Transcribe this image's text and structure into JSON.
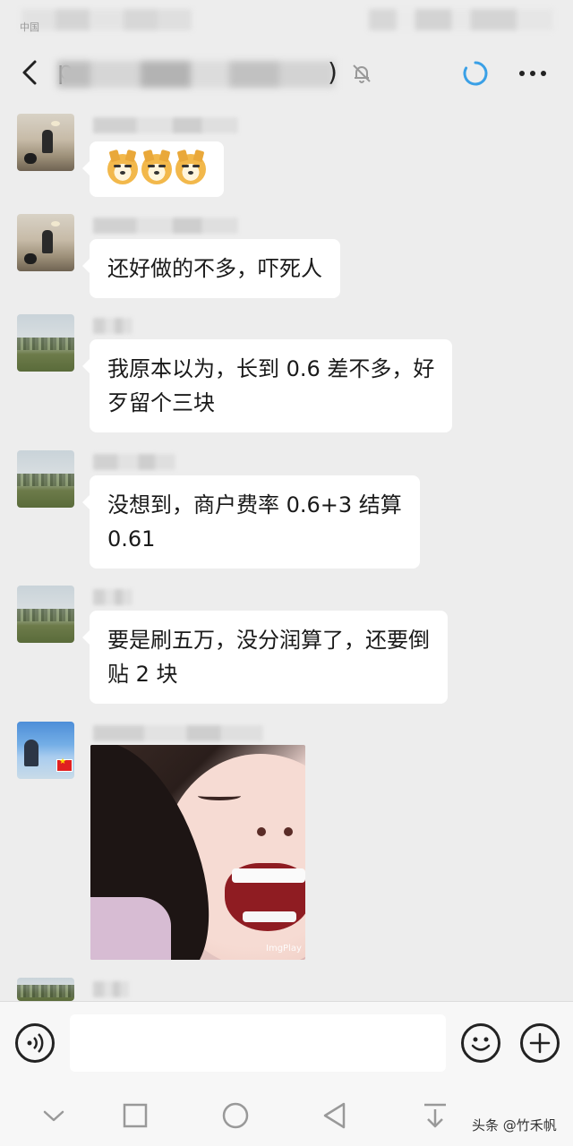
{
  "status_bar": {
    "carrier": "中国"
  },
  "nav": {
    "title": "p",
    "title_suffix": ")"
  },
  "messages": [
    {
      "type": "emoji",
      "avatar": "room-avatar",
      "emojis": [
        "doge",
        "doge",
        "doge"
      ]
    },
    {
      "type": "text",
      "avatar": "room-avatar",
      "text": "还好做的不多，吓死人"
    },
    {
      "type": "text",
      "avatar": "field-avatar",
      "line1": "我原本以为，长到 0.6 差不多，好",
      "line2": "歹留个三块"
    },
    {
      "type": "text",
      "avatar": "field-avatar",
      "line1": "没想到，商户费率 0.6+3  结算",
      "line2": "0.61"
    },
    {
      "type": "text",
      "avatar": "field-avatar",
      "line1": "要是刷五万，没分润算了，还要倒",
      "line2": "贴 2 块"
    },
    {
      "type": "image",
      "avatar": "sky-avatar",
      "watermark": "ImgPlay"
    }
  ],
  "input_bar": {
    "placeholder": ""
  },
  "footer_watermark": "头条 @竹禾帆",
  "colors": {
    "background": "#ededed",
    "bubble": "#ffffff",
    "accent_loading": "#3aa0e6"
  }
}
